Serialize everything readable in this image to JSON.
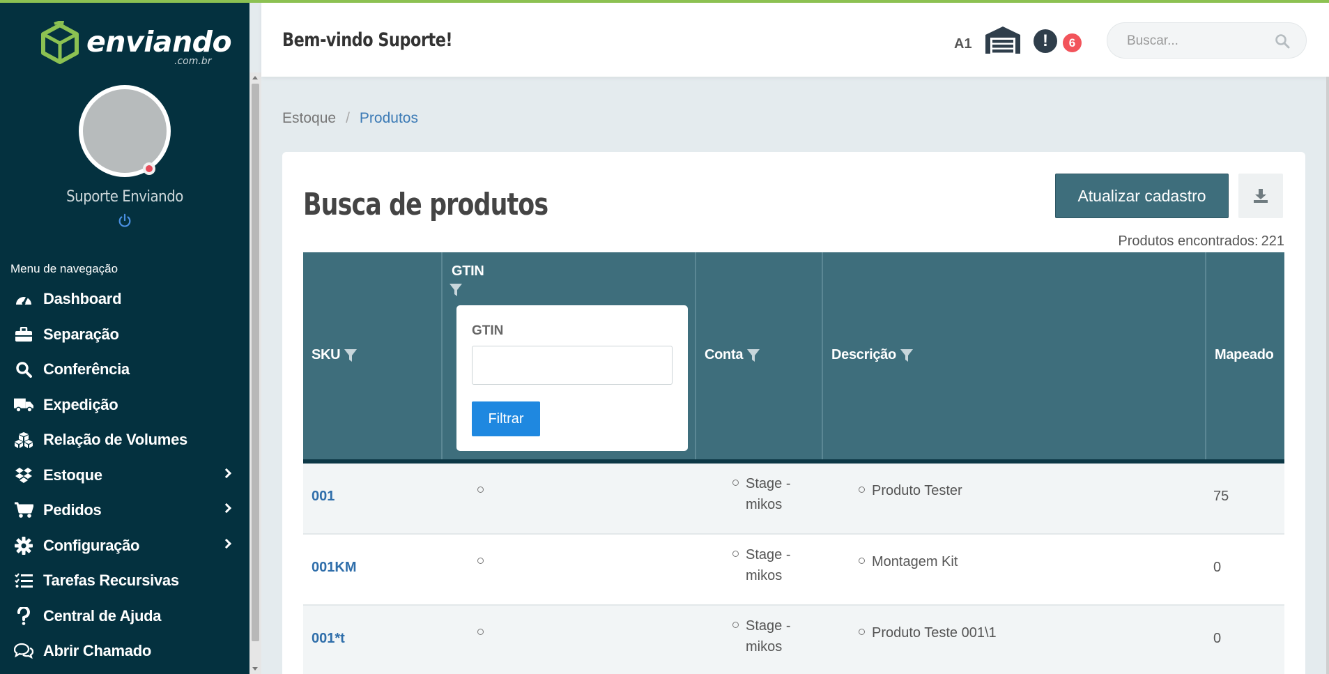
{
  "brand": {
    "name": "enviando",
    "domain": ".com.br",
    "accent": "#8cc152",
    "sidebar_bg": "#04313f",
    "primary": "#3e6e7c"
  },
  "user": {
    "name": "Suporte Enviando"
  },
  "nav": {
    "header": "Menu de navegação",
    "items": [
      {
        "label": "Dashboard",
        "icon": "gauge-icon",
        "submenu": false
      },
      {
        "label": "Separação",
        "icon": "briefcase-icon",
        "submenu": false
      },
      {
        "label": "Conferência",
        "icon": "search-icon",
        "submenu": false
      },
      {
        "label": "Expedição",
        "icon": "truck-icon",
        "submenu": false
      },
      {
        "label": "Relação de Volumes",
        "icon": "boxes-icon",
        "submenu": false
      },
      {
        "label": "Estoque",
        "icon": "dropbox-icon",
        "submenu": true
      },
      {
        "label": "Pedidos",
        "icon": "cart-icon",
        "submenu": true
      },
      {
        "label": "Configuração",
        "icon": "gear-icon",
        "submenu": true
      },
      {
        "label": "Tarefas Recursivas",
        "icon": "tasks-icon",
        "submenu": false
      },
      {
        "label": "Central de Ajuda",
        "icon": "question-icon",
        "submenu": false
      },
      {
        "label": "Abrir Chamado",
        "icon": "chat-icon",
        "submenu": false
      }
    ]
  },
  "header": {
    "welcome": "Bem-vindo Suporte!",
    "location": "A1",
    "alert_count": "6",
    "alert_symbol": "!",
    "search_placeholder": "Buscar..."
  },
  "breadcrumb": {
    "parent": "Estoque",
    "current": "Produtos",
    "separator": "/"
  },
  "page": {
    "title": "Busca de produtos",
    "update_button": "Atualizar cadastro",
    "found_label": "Produtos encontrados:",
    "found_count": "221"
  },
  "table": {
    "columns": [
      "SKU",
      "GTIN",
      "Conta",
      "Descrição",
      "Mapeado"
    ],
    "gtin_filter": {
      "label": "GTIN",
      "value": "",
      "button": "Filtrar"
    },
    "rows": [
      {
        "sku": "001",
        "gtin": "",
        "conta_1": "Stage -",
        "conta_2": "mikos",
        "descricao": "Produto Tester",
        "mapeado": "75"
      },
      {
        "sku": "001KM",
        "gtin": "",
        "conta_1": "Stage -",
        "conta_2": "mikos",
        "descricao": "Montagem Kit",
        "mapeado": "0"
      },
      {
        "sku": "001*t",
        "gtin": "",
        "conta_1": "Stage -",
        "conta_2": "mikos",
        "descricao": "Produto Teste 001\\1",
        "mapeado": "0"
      }
    ]
  }
}
